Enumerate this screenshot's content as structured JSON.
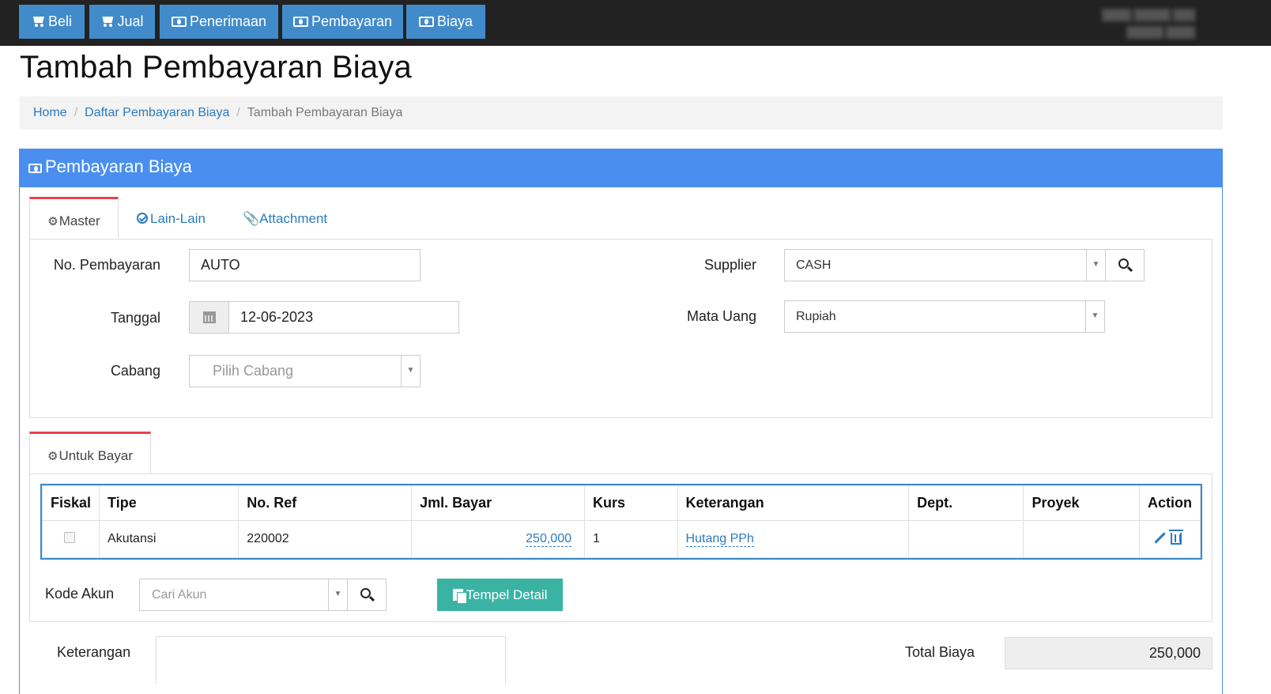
{
  "navbar": {
    "buttons": [
      {
        "label": "Beli",
        "icon": "cart-icon"
      },
      {
        "label": "Jual",
        "icon": "cart-icon"
      },
      {
        "label": "Penerimaan",
        "icon": "money-icon"
      },
      {
        "label": "Pembayaran",
        "icon": "money-icon"
      },
      {
        "label": "Biaya",
        "icon": "money-icon"
      }
    ]
  },
  "page": {
    "title": "Tambah Pembayaran Biaya"
  },
  "breadcrumb": [
    {
      "label": "Home"
    },
    {
      "label": "Daftar Pembayaran Biaya"
    },
    {
      "label": "Tambah Pembayaran Biaya"
    }
  ],
  "panel": {
    "title": "Pembayaran Biaya"
  },
  "tabs": {
    "master": "Master",
    "lain_lain": "Lain-Lain",
    "attachment": "Attachment"
  },
  "form": {
    "no_pembayaran": {
      "label": "No. Pembayaran",
      "value": "AUTO"
    },
    "tanggal": {
      "label": "Tanggal",
      "value": "12-06-2023"
    },
    "cabang": {
      "label": "Cabang",
      "placeholder": "Pilih Cabang"
    },
    "supplier": {
      "label": "Supplier",
      "value": "CASH"
    },
    "mata_uang": {
      "label": "Mata Uang",
      "value": "Rupiah"
    }
  },
  "detail_tab": {
    "label": "Untuk Bayar"
  },
  "detail_table": {
    "columns": [
      "Fiskal",
      "Tipe",
      "No. Ref",
      "Jml. Bayar",
      "Kurs",
      "Keterangan",
      "Dept.",
      "Proyek",
      "Action"
    ],
    "rows": [
      {
        "fiskal": false,
        "tipe": "Akutansi",
        "no_ref": "220002",
        "jml_bayar": "250,000",
        "kurs": "1",
        "keterangan": "Hutang PPh",
        "dept": "",
        "proyek": ""
      }
    ]
  },
  "kode_akun": {
    "label": "Kode Akun",
    "placeholder": "Cari Akun"
  },
  "tempel_detail": {
    "label": "Tempel Detail"
  },
  "footer": {
    "keterangan_label": "Keterangan",
    "total_label": "Total Biaya",
    "total_value": "250,000"
  },
  "colors": {
    "primary": "#428bca",
    "panel_header": "#4a8ff0",
    "tab_accent": "#e8424a",
    "green": "#3bb3a4"
  }
}
